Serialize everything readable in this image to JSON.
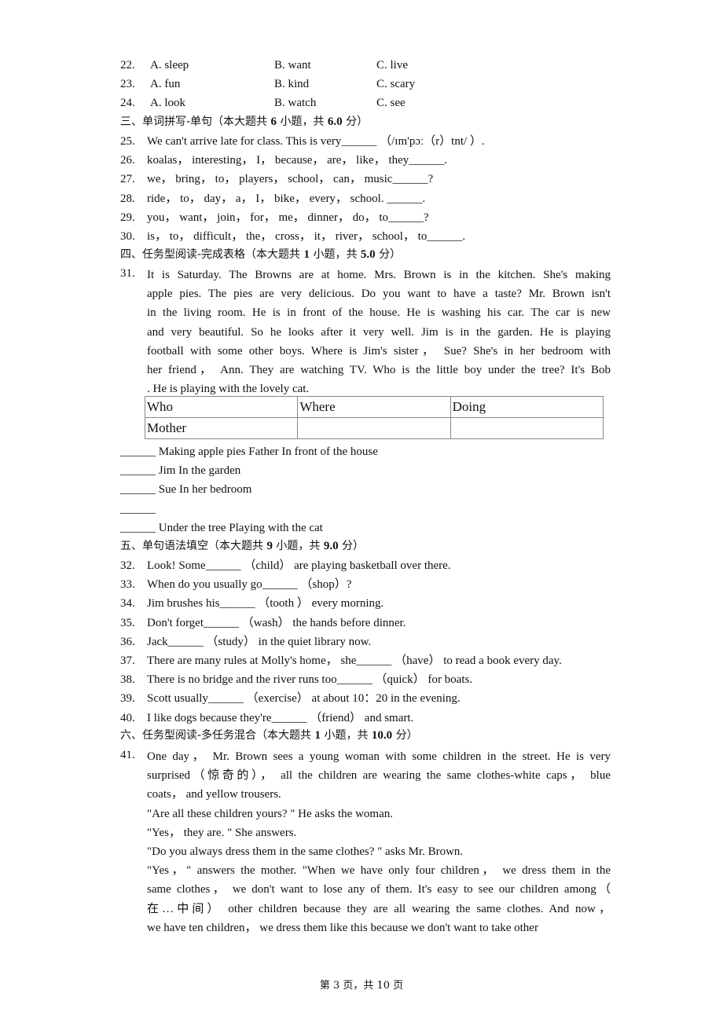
{
  "mc_questions": [
    {
      "num": "22.",
      "a": "A. sleep",
      "b": "B. want",
      "c": "C. live"
    },
    {
      "num": "23.",
      "a": "A. fun",
      "b": "B. kind",
      "c": "C. scary"
    },
    {
      "num": "24.",
      "a": "A. look",
      "b": "B. watch",
      "c": "C. see"
    }
  ],
  "section3": {
    "title_prefix": "三、单词拼写-单句（本大题共 ",
    "count": "6",
    "title_mid": " 小题，共 ",
    "score": "6.0",
    "title_suffix": " 分）",
    "questions": [
      {
        "num": "25.",
        "text": "We can't arrive late for class.   This is very______ （/ɪm'pɔː（r）tnt/ ）."
      },
      {
        "num": "26.",
        "text": "koalas， interesting， I， because， are， like， they______."
      },
      {
        "num": "27.",
        "text": "we， bring， to， players， school， can， music______?"
      },
      {
        "num": "28.",
        "text": "ride， to， day， a， I， bike， every， school. ______."
      },
      {
        "num": "29.",
        "text": "you， want， join， for， me， dinner， do， to______?"
      },
      {
        "num": "30.",
        "text": "is， to， difficult， the， cross， it， river， school， to______."
      }
    ]
  },
  "section4": {
    "title_prefix": "四、任务型阅读-完成表格（本大题共 ",
    "count": "1",
    "title_mid": " 小题，共 ",
    "score": "5.0",
    "title_suffix": " 分）",
    "qnum": "31.",
    "passage_lines": [
      "It is Saturday.   The Browns are at home.   Mrs.   Brown is in the kitchen.   She's making",
      "apple pies.  The pies are very delicious.  Do you want to have a taste?   Mr.  Brown isn't",
      "in the living room.   He is in front of the house.   He is washing his car.   The car is new",
      "and very beautiful.   So he looks after it very well.   Jim is in the garden.   He is playing",
      "football with some other boys.   Where is Jim's sister，  Sue?   She's in her bedroom with",
      "her friend，  Ann.  They are watching TV.  Who is the little boy under the tree?   It's Bob",
      ".   He is playing with the lovely cat."
    ],
    "table": {
      "headers": [
        "Who",
        "Where",
        "Doing"
      ],
      "rows": [
        [
          "Mother",
          "",
          ""
        ]
      ]
    },
    "fill_lines": [
      "______ Making apple pies Father In front of the house",
      "______ Jim In the garden",
      "______ Sue In her bedroom",
      "______",
      "______ Under the tree Playing with the cat"
    ]
  },
  "section5": {
    "title_prefix": "五、单句语法填空（本大题共 ",
    "count": "9",
    "title_mid": " 小题，共 ",
    "score": "9.0",
    "title_suffix": " 分）",
    "questions": [
      {
        "num": "32.",
        "text": "Look! Some______ （child） are playing basketball over there."
      },
      {
        "num": "33.",
        "text": "When do you usually go______ （shop）?"
      },
      {
        "num": "34.",
        "text": "Jim brushes his______ （tooth ） every morning."
      },
      {
        "num": "35.",
        "text": "Don't forget______ （wash） the hands before dinner."
      },
      {
        "num": "36.",
        "text": "Jack______ （study） in the quiet library now."
      },
      {
        "num": "37.",
        "text": "There are many rules at Molly's home，  she______ （have） to read a book every day."
      },
      {
        "num": "38.",
        "text": "There is no bridge and the river runs too______ （quick） for boats."
      },
      {
        "num": "39.",
        "text": "Scott usually______ （exercise） at about 10：20  in the evening."
      },
      {
        "num": "40.",
        "text": "I like dogs because they're______  （friend） and smart."
      }
    ]
  },
  "section6": {
    "title_prefix": "六、任务型阅读-多任务混合（本大题共 ",
    "count": "1",
    "title_mid": " 小题，共 ",
    "score": "10.0",
    "title_suffix": " 分）",
    "qnum": "41.",
    "passage_lines": [
      {
        "text": "One day，  Mr.  Brown sees a young woman with some children in the street.  He is very",
        "justify": true
      },
      {
        "text": "surprised（惊奇的），   all the children are wearing the same clothes-white caps，   blue",
        "justify": true
      },
      {
        "text": "coats，  and yellow trousers.",
        "justify": false
      },
      {
        "text": "\"Are all these children yours? \" He asks the woman.",
        "justify": false
      },
      {
        "text": "\"Yes，  they are. \" She answers.",
        "justify": false
      },
      {
        "text": "\"Do you always dress them in the same clothes? \" asks Mr.   Brown.",
        "justify": false
      },
      {
        "text": "\"Yes，\" answers the mother.   \"When we have only four children，  we dress them in the",
        "justify": true
      },
      {
        "text": "same clothes，  we don't want to lose any of them.  It's easy to see our children among（",
        "justify": true
      },
      {
        "text": "在…中间） other children because they are all wearing the same clothes.   And now，",
        "justify": true
      },
      {
        "text": "we have ten children，  we dress them like this because we don't want to take other",
        "justify": false
      }
    ]
  },
  "footer": {
    "page_text": "第 3 页，共 10 页"
  }
}
